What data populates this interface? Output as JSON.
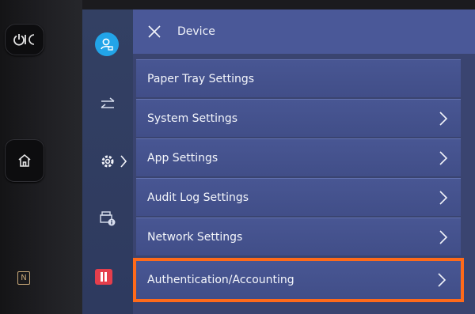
{
  "header": {
    "title": "Device"
  },
  "menu": {
    "items": [
      {
        "label": "Paper Tray Settings"
      },
      {
        "label": "System Settings"
      },
      {
        "label": "App Settings"
      },
      {
        "label": "Audit Log Settings"
      },
      {
        "label": "Network Settings"
      },
      {
        "label": "Authentication/Accounting"
      }
    ]
  },
  "hardware": {
    "power_icon": "power-sleep-icon",
    "home_icon": "home-icon",
    "nfc_label": "N"
  },
  "colors": {
    "accent_blue": "#22a4e8",
    "highlight_orange": "#ff6a1a",
    "pause_red": "#e53e4c"
  }
}
